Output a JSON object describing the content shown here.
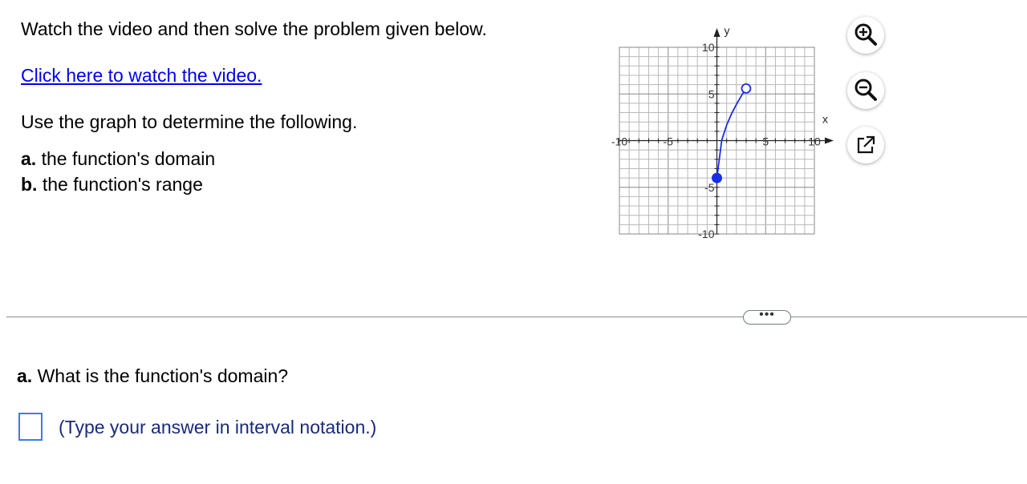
{
  "intro": {
    "instruction": "Watch the video and then solve the problem given below.",
    "video_link": "Click here to watch the video.",
    "prompt": "Use the graph to determine the following.",
    "part_a_letter": "a.",
    "part_a_text": " the function's domain",
    "part_b_letter": "b.",
    "part_b_text": " the function's range"
  },
  "graph": {
    "x_axis_label": "x",
    "y_axis_label": "y",
    "x_ticks": [
      "-10",
      "-5",
      "5",
      "10"
    ],
    "y_ticks": [
      "10",
      "5",
      "-5",
      "-10"
    ]
  },
  "chart_data": {
    "type": "line",
    "x_axis_label": "x",
    "y_axis_label": "y",
    "xlim": [
      -10,
      10
    ],
    "ylim": [
      -10,
      10
    ],
    "grid": true,
    "series": [
      {
        "x": [
          0,
          0.5,
          1,
          1.5,
          2,
          2.5,
          3
        ],
        "y": [
          -4,
          0.07,
          1.66,
          2.87,
          3.88,
          4.78,
          5.59
        ],
        "color": "#1a2ee8"
      }
    ],
    "points": [
      {
        "x": 0,
        "y": -4,
        "style": "closed"
      },
      {
        "x": 3,
        "y": 5.59,
        "style": "open"
      }
    ]
  },
  "toolbar": {
    "zoom_in": "zoom-in-icon",
    "zoom_out": "zoom-out-icon",
    "popout": "popout-icon"
  },
  "more_button": "•••",
  "question": {
    "letter": "a.",
    "text": " What is the function's domain?",
    "answer_value": "",
    "hint": "(Type your answer in interval notation.)"
  },
  "colors": {
    "link": "#0000ee",
    "hint": "#1a2a7a",
    "curve": "#1a2ee8",
    "input_border": "#3d7de0"
  }
}
